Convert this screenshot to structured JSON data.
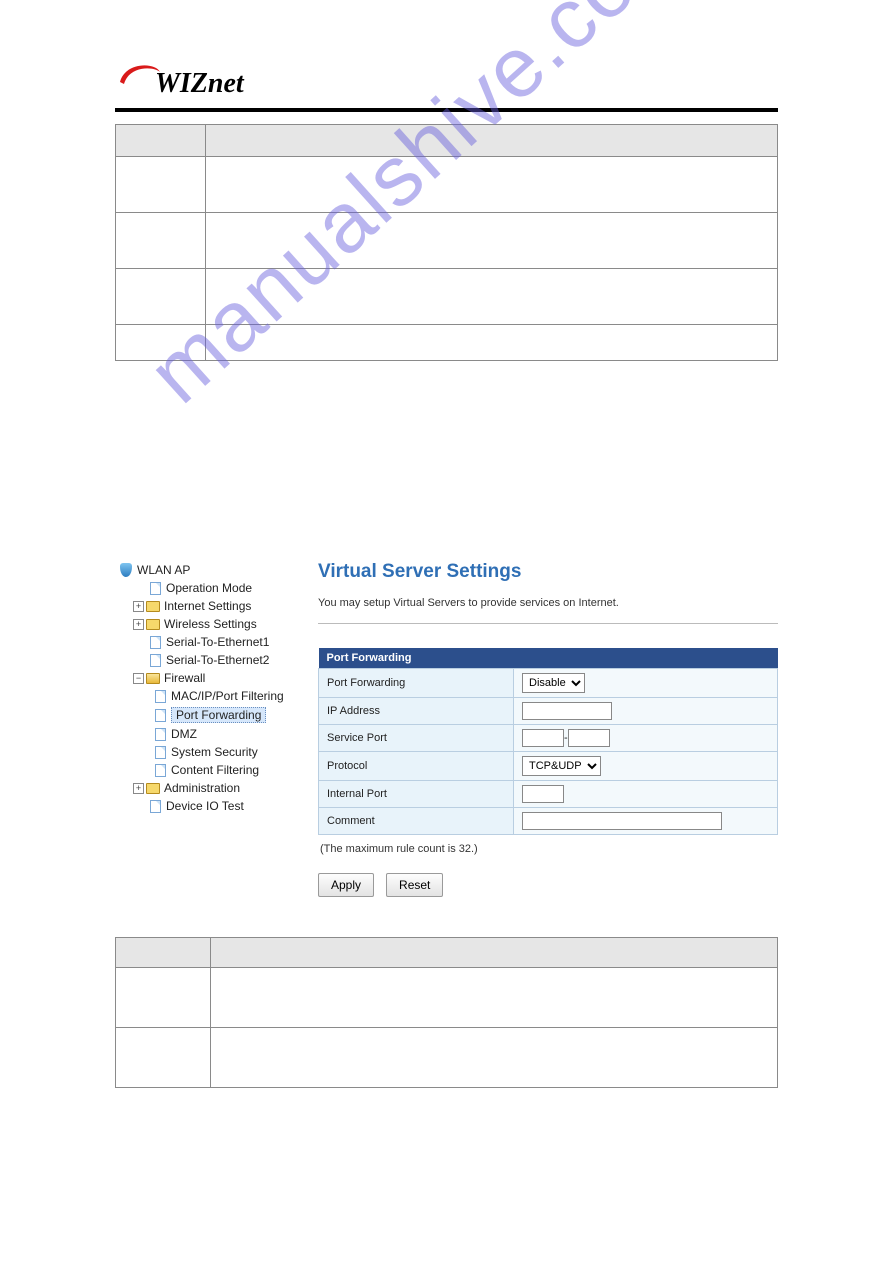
{
  "logo_text": "WIZnet",
  "watermark": "manualshive.com",
  "tree": {
    "root": "WLAN AP",
    "items": [
      {
        "label": "Operation Mode"
      },
      {
        "label": "Internet Settings"
      },
      {
        "label": "Wireless Settings"
      },
      {
        "label": "Serial-To-Ethernet1"
      },
      {
        "label": "Serial-To-Ethernet2"
      },
      {
        "label": "Firewall"
      },
      {
        "label": "MAC/IP/Port Filtering"
      },
      {
        "label": "Port Forwarding"
      },
      {
        "label": "DMZ"
      },
      {
        "label": "System Security"
      },
      {
        "label": "Content Filtering"
      },
      {
        "label": "Administration"
      },
      {
        "label": "Device IO Test"
      }
    ]
  },
  "content": {
    "title": "Virtual Server Settings",
    "desc": "You may setup Virtual Servers to provide services on Internet.",
    "section_header": "Port Forwarding",
    "rows": {
      "port_forwarding_label": "Port Forwarding",
      "port_forwarding_value": "Disable",
      "ip_label": "IP Address",
      "service_port_label": "Service Port",
      "protocol_label": "Protocol",
      "protocol_value": "TCP&UDP",
      "internal_port_label": "Internal Port",
      "comment_label": "Comment"
    },
    "note": "(The maximum rule count is 32.)",
    "buttons": {
      "apply": "Apply",
      "reset": "Reset"
    }
  }
}
